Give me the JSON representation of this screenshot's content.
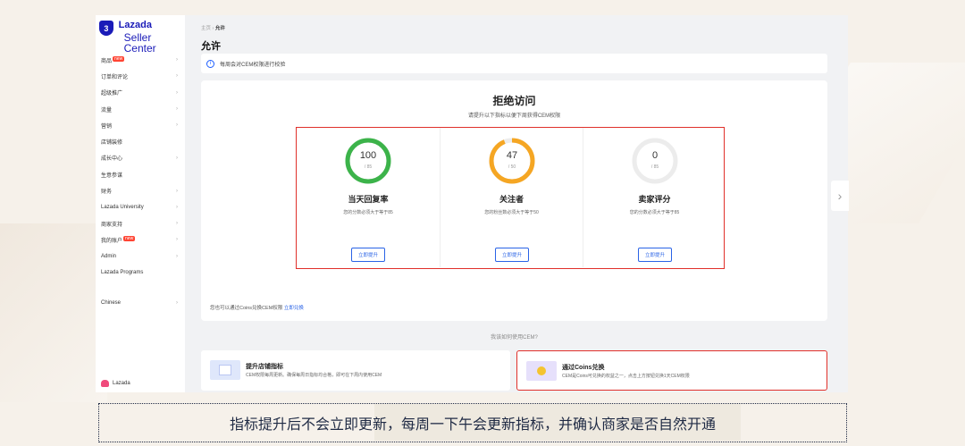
{
  "sidebar": {
    "logo_line1": "Lazada",
    "logo_line2": "Seller Center",
    "logo_mark": "3",
    "items": [
      {
        "label": "商品",
        "badge": "new",
        "chevron": true
      },
      {
        "label": "订单和评论",
        "badge": "",
        "chevron": true
      },
      {
        "label": "超级推广",
        "badge": "",
        "chevron": true
      },
      {
        "label": "流量",
        "badge": "",
        "chevron": true
      },
      {
        "label": "营销",
        "badge": "",
        "chevron": true
      },
      {
        "label": "店铺装修",
        "badge": "",
        "chevron": false
      },
      {
        "label": "成长中心",
        "badge": "",
        "chevron": true
      },
      {
        "label": "生意参谋",
        "badge": "",
        "chevron": false
      },
      {
        "label": "财务",
        "badge": "",
        "chevron": true
      },
      {
        "label": "Lazada University",
        "badge": "",
        "chevron": true
      },
      {
        "label": "商家支持",
        "badge": "",
        "chevron": true
      },
      {
        "label": "我的账户",
        "badge": "new",
        "chevron": true
      },
      {
        "label": "Admin",
        "badge": "",
        "chevron": true
      },
      {
        "label": "Lazada Programs",
        "badge": "",
        "chevron": false
      }
    ],
    "language": "Chinese",
    "footer_brand": "Lazada"
  },
  "breadcrumb": {
    "home": "主页",
    "sep": "›",
    "current": "允许"
  },
  "page_title": "允许",
  "notice": {
    "text": "每周会对CEM权限进行校验"
  },
  "main_card": {
    "title": "拒绝访问",
    "subtitle": "请提升以下指标以便下周获得CEM权限",
    "metrics": [
      {
        "value": "100",
        "denominator": "/ 85",
        "title": "当天回复率",
        "desc": "您的分数必须大于等于85",
        "button": "立即提升",
        "progress": 1.0,
        "color": "#3cb34a"
      },
      {
        "value": "47",
        "denominator": "/ 50",
        "title": "关注者",
        "desc": "您的粉丝数必须大于等于50",
        "button": "立即提升",
        "progress": 0.94,
        "color": "#f5a623"
      },
      {
        "value": "0",
        "denominator": "/ 85",
        "title": "卖家评分",
        "desc": "您的分数必须大于等于85",
        "button": "立即提升",
        "progress": 0,
        "color": "#e8e8e8"
      }
    ],
    "coins_note": "您也可以通过Coins兑换CEM权限",
    "coins_link": "立即兑换"
  },
  "how_to": "我该如何使用CEM?",
  "options": [
    {
      "title": "提升店铺指标",
      "desc": "CEM权限每周更新。确保每周日指标均合格，即可在下周内使用CEM"
    },
    {
      "title": "通过Coins兑换",
      "desc": "CEM是Coins可兑换的权益之一，点击上方按钮兑换1天CEM权限"
    }
  ],
  "nav_arrow": "›",
  "banner_text": "指标提升后不会立即更新，每周一下午会更新指标，并确认商家是否自然开通"
}
